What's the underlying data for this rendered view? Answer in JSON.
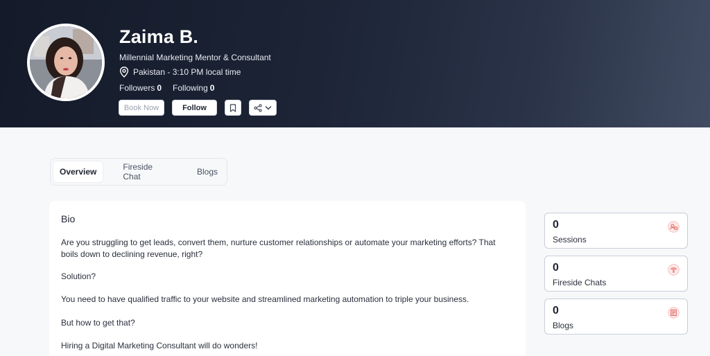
{
  "profile": {
    "name": "Zaima B.",
    "headline": "Millennial Marketing Mentor & Consultant",
    "location": "Pakistan - 3:10 PM local time",
    "followers_label": "Followers",
    "followers_count": "0",
    "following_label": "Following",
    "following_count": "0"
  },
  "actions": {
    "book_now": "Book Now",
    "follow": "Follow"
  },
  "tabs": [
    {
      "label": "Overview",
      "active": true
    },
    {
      "label": "Fireside Chat",
      "active": false
    },
    {
      "label": "Blogs",
      "active": false
    }
  ],
  "bio": {
    "title": "Bio",
    "paragraphs": [
      "Are you struggling to get leads, convert them, nurture customer relationships or automate your marketing efforts? That boils down to declining revenue, right?",
      "Solution?",
      "You need to have qualified traffic to your website and streamlined marketing automation to triple your business.",
      "But how to get that?",
      "Hiring a Digital Marketing Consultant will do wonders!"
    ]
  },
  "stats": [
    {
      "value": "0",
      "label": "Sessions",
      "icon": "sessions-icon"
    },
    {
      "value": "0",
      "label": "Fireside Chats",
      "icon": "fireside-icon"
    },
    {
      "value": "0",
      "label": "Blogs",
      "icon": "blogs-icon"
    }
  ],
  "colors": {
    "hero_start": "#141a29",
    "hero_end": "#414c62",
    "icon_red": "#e0605a"
  }
}
